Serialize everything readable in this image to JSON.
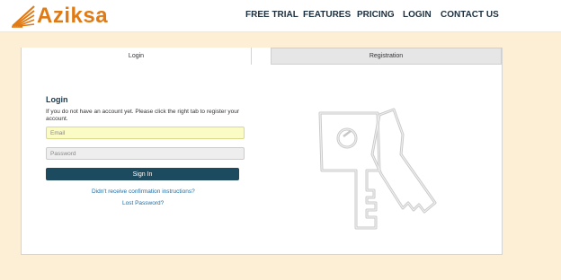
{
  "header": {
    "logo_text": "Aziksa",
    "nav": {
      "free_trial": "FREE TRIAL",
      "features": "FEATURES",
      "pricing": "PRICING",
      "login": "LOGIN",
      "contact": "CONTACT US"
    }
  },
  "tabs": {
    "login": "Login",
    "registration": "Registration"
  },
  "login_form": {
    "title": "Login",
    "description": "If you do not have an account yet. Please click the right tab to register your account.",
    "email_placeholder": "Email",
    "password_placeholder": "Password",
    "sign_in_label": "Sign In",
    "confirm_link": "Didn't receive confirmation instructions?",
    "lost_password_link": "Lost Password?"
  },
  "colors": {
    "page_background": "#fdefd6",
    "brand_orange": "#e07a14",
    "nav_text": "#1c2f3e",
    "button_bg": "#1c4a5e",
    "link": "#1b6fa8",
    "email_field_bg": "#fbfbc6"
  },
  "icons": {
    "logo_mark": "feather-fan-icon",
    "illustration": "keys-icon"
  }
}
